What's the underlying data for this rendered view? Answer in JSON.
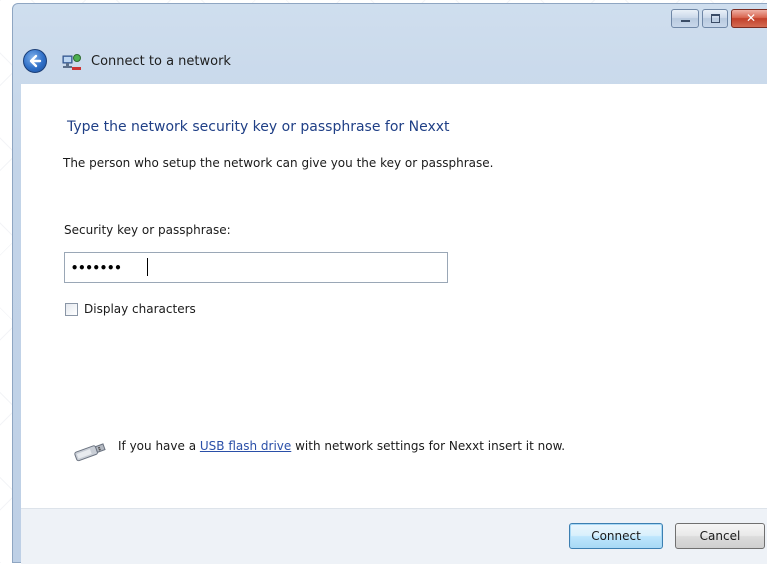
{
  "window": {
    "title": "Connect to a network"
  },
  "dialog": {
    "heading": "Type the network security key or passphrase for Nexxt",
    "instruction": "The person who setup the network can give you the key or passphrase.",
    "key_label": "Security key or passphrase:",
    "key_value": "•••••••",
    "display_characters_label": "Display characters",
    "display_characters_checked": false
  },
  "usb": {
    "text_before": "If you have a ",
    "link_text": "USB flash drive",
    "text_after": " with network settings for Nexxt insert it now."
  },
  "buttons": {
    "connect": "Connect",
    "cancel": "Cancel"
  },
  "icons": {
    "back": "back-arrow-icon",
    "network": "network-icon",
    "usb": "usb-drive-icon",
    "minimize": "minimize-icon",
    "maximize": "maximize-icon",
    "close": "close-icon"
  },
  "colors": {
    "heading": "#1f3f86",
    "link": "#2a4fa8",
    "close_button": "#c2402a",
    "primary_button_border": "#3c7fb1"
  }
}
